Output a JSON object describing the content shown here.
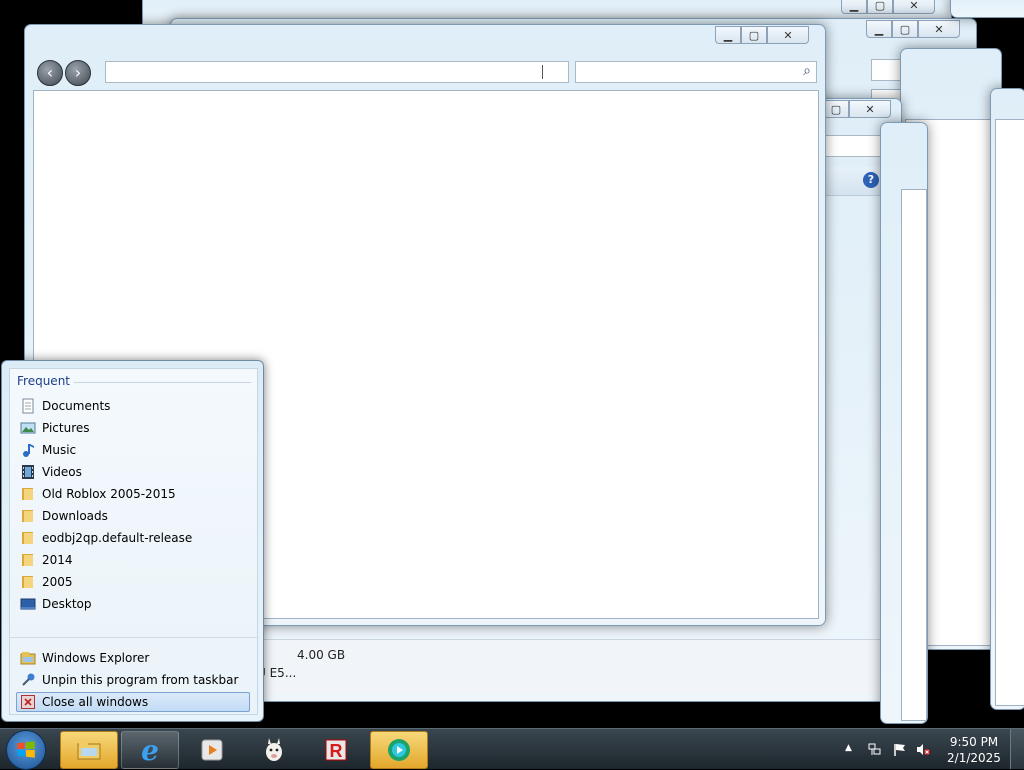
{
  "background_window": {
    "memory_label": "4.00 GB",
    "cpu_label": "U E5..."
  },
  "jumplist": {
    "section_title": "Frequent",
    "items": [
      {
        "label": "Documents",
        "icon": "documents-icon"
      },
      {
        "label": "Pictures",
        "icon": "pictures-icon"
      },
      {
        "label": "Music",
        "icon": "music-icon"
      },
      {
        "label": "Videos",
        "icon": "videos-icon"
      },
      {
        "label": "Old Roblox 2005-2015",
        "icon": "folder-icon"
      },
      {
        "label": "Downloads",
        "icon": "folder-icon"
      },
      {
        "label": "eodbj2qp.default-release",
        "icon": "folder-icon"
      },
      {
        "label": "2014",
        "icon": "folder-icon"
      },
      {
        "label": "2005",
        "icon": "folder-icon"
      },
      {
        "label": "Desktop",
        "icon": "desktop-icon"
      }
    ],
    "tasks": [
      {
        "label": "Windows Explorer",
        "icon": "windows-explorer-icon"
      },
      {
        "label": "Unpin this program from taskbar",
        "icon": "unpin-icon"
      },
      {
        "label": "Close all windows",
        "icon": "close-all-icon"
      }
    ]
  },
  "taskbar": {
    "clock_time": "9:50 PM",
    "clock_date": "2/1/2025",
    "pinned": [
      "windows-explorer",
      "internet-explorer",
      "media-player",
      "llama-app",
      "roblox",
      "media-app"
    ]
  },
  "colors": {
    "jumplist_heading": "#1e3e8a",
    "highlight": "#c1dbf5",
    "taskbar": "#1d262c",
    "active_button": "#e3a72b"
  }
}
